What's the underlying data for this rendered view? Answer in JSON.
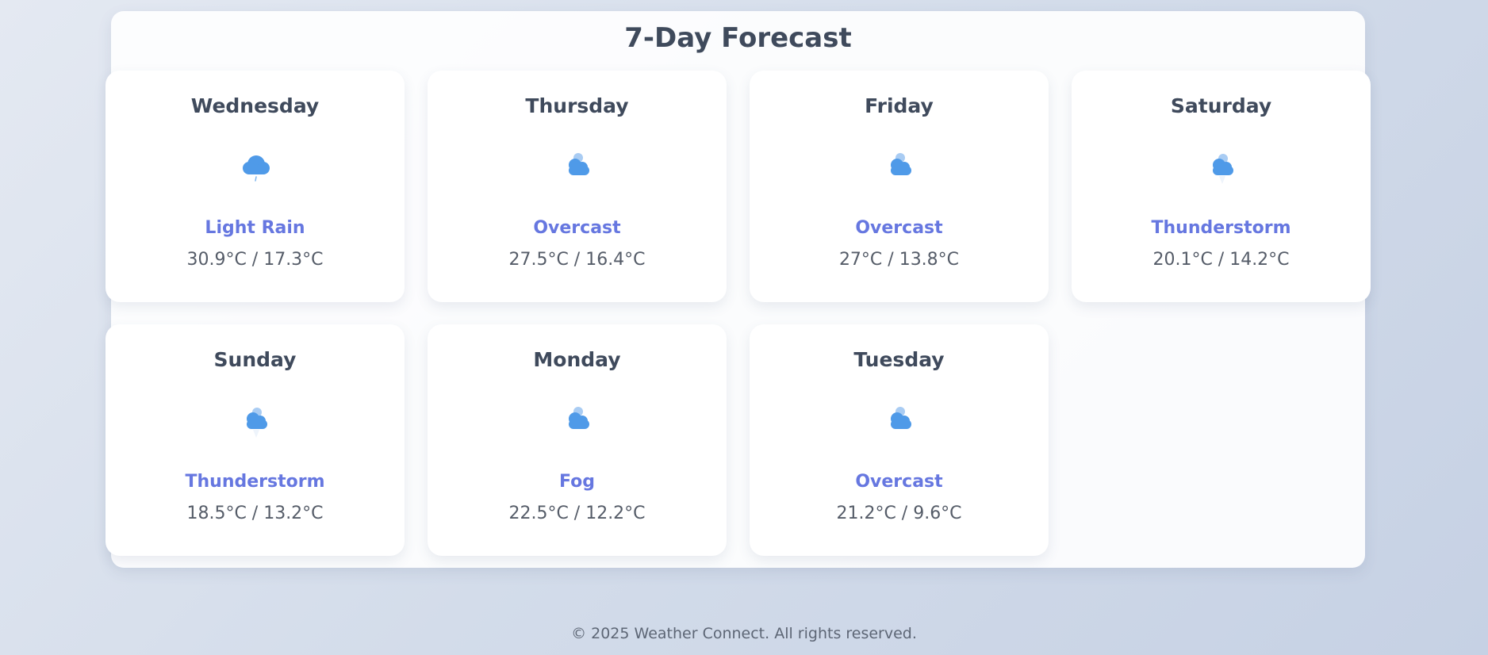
{
  "header": {
    "title": "7-Day Forecast"
  },
  "forecast": [
    {
      "day": "Wednesday",
      "condition": "Light Rain",
      "temps": "30.9°C / 17.3°C",
      "icon": "rain-cloud-icon"
    },
    {
      "day": "Thursday",
      "condition": "Overcast",
      "temps": "27.5°C / 16.4°C",
      "icon": "cloud-sun-icon"
    },
    {
      "day": "Friday",
      "condition": "Overcast",
      "temps": "27°C / 13.8°C",
      "icon": "cloud-sun-icon"
    },
    {
      "day": "Saturday",
      "condition": "Thunderstorm",
      "temps": "20.1°C / 14.2°C",
      "icon": "thunderstorm-icon"
    },
    {
      "day": "Sunday",
      "condition": "Thunderstorm",
      "temps": "18.5°C / 13.2°C",
      "icon": "thunderstorm-icon"
    },
    {
      "day": "Monday",
      "condition": "Fog",
      "temps": "22.5°C / 12.2°C",
      "icon": "cloud-sun-icon"
    },
    {
      "day": "Tuesday",
      "condition": "Overcast",
      "temps": "21.2°C / 9.6°C",
      "icon": "cloud-sun-icon"
    }
  ],
  "footer": {
    "text": "© 2025 Weather Connect. All rights reserved."
  },
  "colors": {
    "accent": "#6677e0",
    "icon_blue": "#4f9ae8",
    "heading": "#3f4a5c"
  }
}
